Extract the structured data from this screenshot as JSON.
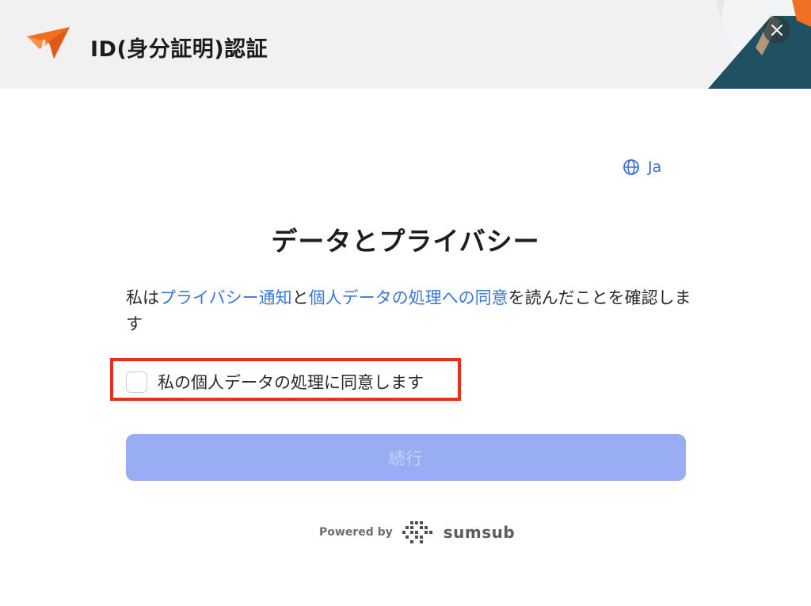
{
  "header": {
    "title": "ID(身分証明)認証",
    "close_icon": "close-icon",
    "logo_icon": "brand-arrow-logo"
  },
  "language": {
    "icon": "globe-icon",
    "label": "Ja"
  },
  "main": {
    "title": "データとプライバシー",
    "consent": {
      "prefix": "私は",
      "privacy_link": "プライバシー通知",
      "middle": "と",
      "processing_link": "個人データの処理への同意",
      "suffix": "を読んだことを確認します"
    },
    "checkbox": {
      "label": "私の個人データの処理に同意します",
      "checked": false
    },
    "continue_button": {
      "label": "続行",
      "disabled": true
    }
  },
  "footer": {
    "powered_by": "Powered by",
    "brand": "sumsub",
    "brand_icon": "sumsub-logo-icon"
  },
  "colors": {
    "accent": "#3a78d8",
    "button_disabled": "#98adf3",
    "highlight": "#ea2e1d",
    "brand_orange": "#f36d21",
    "header_bg": "#f1f1f2"
  }
}
